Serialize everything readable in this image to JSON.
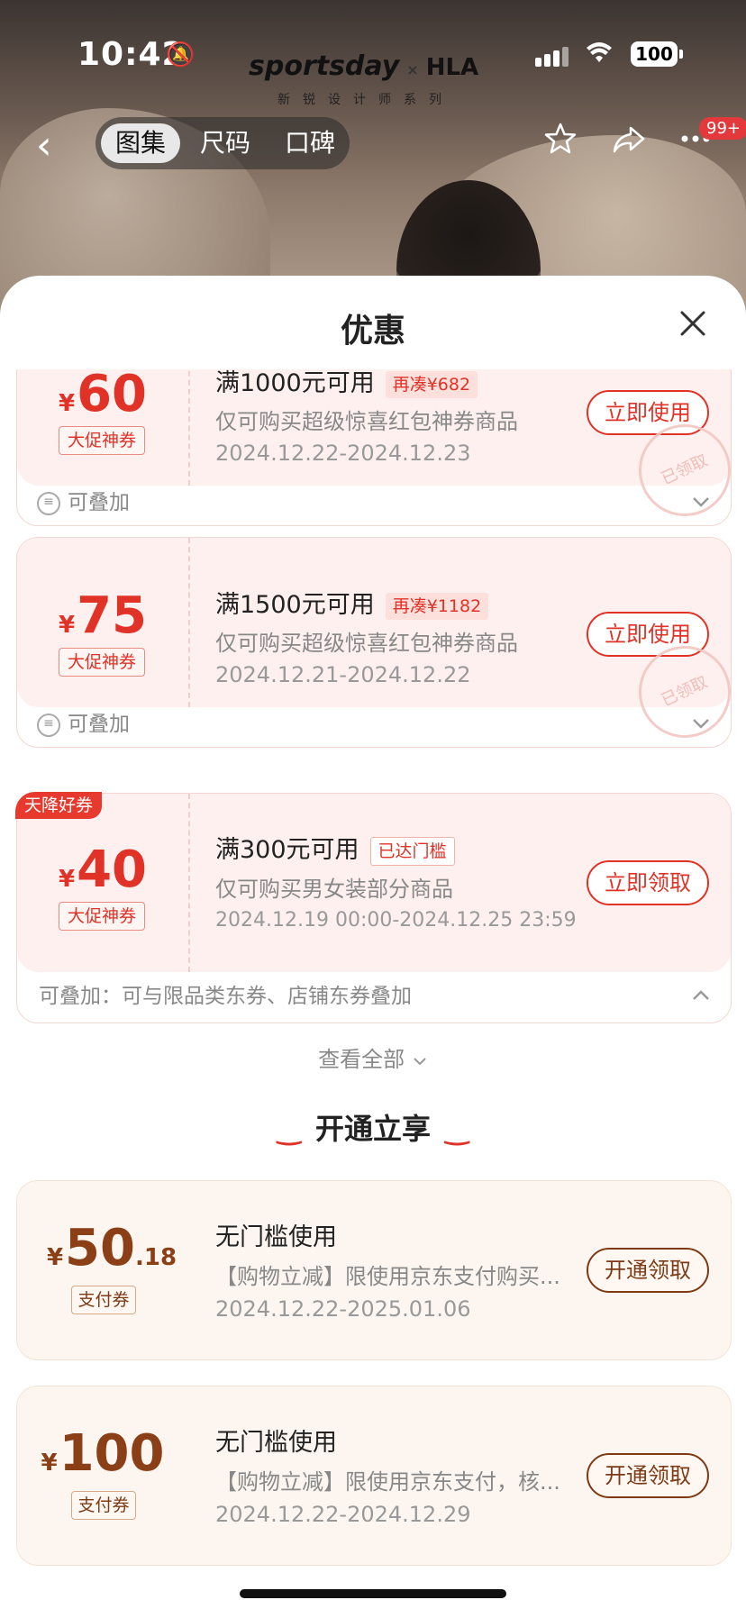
{
  "status": {
    "time": "10:42",
    "battery": "100"
  },
  "brand": {
    "name": "sportsday",
    "x": "×",
    "partner": "HLA",
    "subtitle": "新锐设计师系列"
  },
  "nav": {
    "back": "‹",
    "tabs": [
      "图集",
      "尺码",
      "口碑"
    ],
    "active_tab": 0,
    "badge": "99+"
  },
  "sheet": {
    "title": "优惠",
    "close": "✕"
  },
  "coupons": [
    {
      "yen": "¥",
      "amount": "60",
      "tag": "大促神券",
      "title": "满1000元可用",
      "chip": "再凑¥682",
      "desc": "仅可购买超级惊喜红包神券商品",
      "date": "2024.12.22-2024.12.23",
      "button": "立即使用",
      "stamp": "已领取",
      "footer": "可叠加"
    },
    {
      "yen": "¥",
      "amount": "75",
      "tag": "大促神券",
      "title": "满1500元可用",
      "chip": "再凑¥1182",
      "desc": "仅可购买超级惊喜红包神券商品",
      "date": "2024.12.21-2024.12.22",
      "button": "立即使用",
      "stamp": "已领取",
      "footer": "可叠加"
    },
    {
      "flag": "天降好券",
      "yen": "¥",
      "amount": "40",
      "tag": "大促神券",
      "title": "满300元可用",
      "chip": "已达门槛",
      "desc": "仅可购买男女装部分商品",
      "date": "2024.12.19 00:00-2024.12.25 23:59",
      "button": "立即领取",
      "footer": "可叠加：可与限品类东券、店铺东券叠加"
    }
  ],
  "view_all": "查看全部",
  "section_title": "开通立享",
  "pay_coupons": [
    {
      "yen": "¥",
      "amount": "50",
      "decimal": ".18",
      "tag": "支付券",
      "title": "无门槛使用",
      "desc": "【购物立减】限使用京东支付购买...",
      "date": "2024.12.22-2025.01.06",
      "button": "开通领取"
    },
    {
      "yen": "¥",
      "amount": "100",
      "tag": "支付券",
      "title": "无门槛使用",
      "desc": "【购物立减】限使用京东支付，核...",
      "date": "2024.12.22-2024.12.29",
      "button": "开通领取"
    }
  ],
  "icons": {
    "back": "chevron-left-icon",
    "star": "star-icon",
    "share": "share-icon",
    "more": "more-icon",
    "close": "close-icon",
    "stack": "stack-icon",
    "chevron": "chevron-down-icon"
  },
  "colors": {
    "accent": "#e03227",
    "gold": "#7e3a15"
  }
}
